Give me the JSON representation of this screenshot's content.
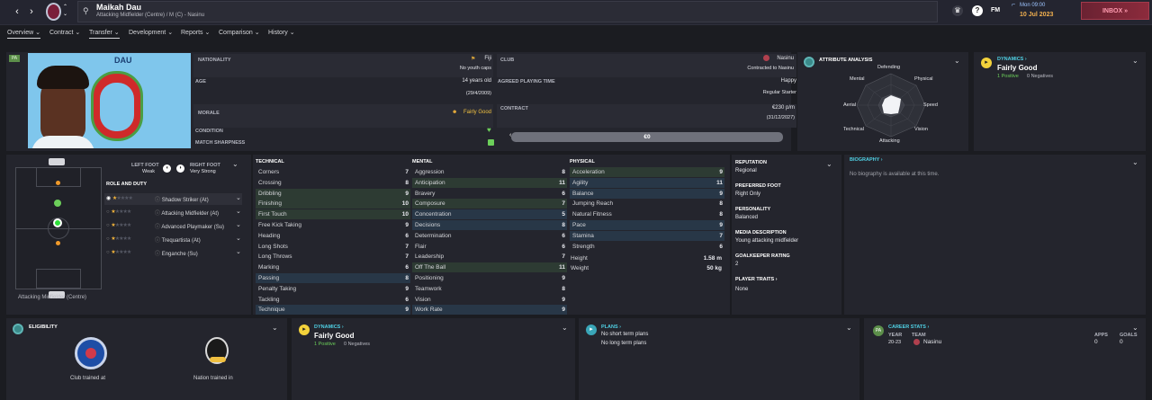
{
  "topbar": {
    "name": "Maikah Dau",
    "subtitle": "Attacking Midfielder (Centre) / M (C) - Nasinu",
    "day": "Mon 09:00",
    "date": "10 Jul 2023",
    "fm": "FM",
    "inbox": "INBOX"
  },
  "tabs": [
    {
      "label": "Overview"
    },
    {
      "label": "Contract"
    },
    {
      "label": "Transfer"
    },
    {
      "label": "Development"
    },
    {
      "label": "Reports"
    },
    {
      "label": "Comparison"
    },
    {
      "label": "History"
    }
  ],
  "profile": {
    "shirt_name": "DAU",
    "shirt_number": "0",
    "badge": "PA",
    "nationality_label": "NATIONALITY",
    "nationality": "Fiji",
    "youth_caps": "No youth caps",
    "club_label": "CLUB",
    "club": "Nasinu",
    "contracted": "Contracted to Nasinu",
    "age_label": "AGE",
    "age": "14 years old",
    "dob": "(29/4/2009)",
    "apt_label": "AGREED PLAYING TIME",
    "apt1": "Happy",
    "apt2": "Regular Starter",
    "morale_label": "MORALE",
    "morale": "Fairly Good",
    "contract_label": "CONTRACT",
    "wage": "€230 p/m",
    "expiry": "(31/12/2027)",
    "condition_label": "CONDITION",
    "sharpness_label": "MATCH SHARPNESS",
    "value": "€0"
  },
  "attr_analysis": {
    "title": "ATTRIBUTE ANALYSIS",
    "labels": [
      "Defending",
      "Physical",
      "Speed",
      "Vision",
      "Attacking",
      "Technical",
      "Aerial",
      "Mental"
    ]
  },
  "dynamics": {
    "title": "DYNAMICS",
    "value": "Fairly Good",
    "positive": "1 Positive",
    "negatives": "0 Negatives"
  },
  "feet": {
    "left_label": "LEFT FOOT",
    "left": "Weak",
    "right_label": "RIGHT FOOT",
    "right": "Very Strong"
  },
  "roles": {
    "title": "ROLE AND DUTY",
    "items": [
      "Shadow Striker (At)",
      "Attacking Midfielder (At)",
      "Advanced Playmaker (Su)",
      "Trequartista (At)",
      "Enganche (Su)"
    ]
  },
  "pitch_caption": "Attacking Midfielder (Centre)",
  "technical": {
    "title": "TECHNICAL",
    "attrs": [
      [
        "Corners",
        "7"
      ],
      [
        "Crossing",
        "8"
      ],
      [
        "Dribbling",
        "9"
      ],
      [
        "Finishing",
        "10"
      ],
      [
        "First Touch",
        "10"
      ],
      [
        "Free Kick Taking",
        "9"
      ],
      [
        "Heading",
        "6"
      ],
      [
        "Long Shots",
        "7"
      ],
      [
        "Long Throws",
        "7"
      ],
      [
        "Marking",
        "6"
      ],
      [
        "Passing",
        "8"
      ],
      [
        "Penalty Taking",
        "9"
      ],
      [
        "Tackling",
        "6"
      ],
      [
        "Technique",
        "9"
      ]
    ]
  },
  "mental": {
    "title": "MENTAL",
    "attrs": [
      [
        "Aggression",
        "8"
      ],
      [
        "Anticipation",
        "11"
      ],
      [
        "Bravery",
        "6"
      ],
      [
        "Composure",
        "7"
      ],
      [
        "Concentration",
        "5"
      ],
      [
        "Decisions",
        "8"
      ],
      [
        "Determination",
        "6"
      ],
      [
        "Flair",
        "6"
      ],
      [
        "Leadership",
        "7"
      ],
      [
        "Off The Ball",
        "11"
      ],
      [
        "Positioning",
        "9"
      ],
      [
        "Teamwork",
        "8"
      ],
      [
        "Vision",
        "9"
      ],
      [
        "Work Rate",
        "9"
      ]
    ]
  },
  "physical": {
    "title": "PHYSICAL",
    "attrs": [
      [
        "Acceleration",
        "9"
      ],
      [
        "Agility",
        "11"
      ],
      [
        "Balance",
        "9"
      ],
      [
        "Jumping Reach",
        "8"
      ],
      [
        "Natural Fitness",
        "8"
      ],
      [
        "Pace",
        "9"
      ],
      [
        "Stamina",
        "7"
      ],
      [
        "Strength",
        "6"
      ]
    ],
    "height_label": "Height",
    "height": "1.58 m",
    "weight_label": "Weight",
    "weight": "50 kg"
  },
  "info": {
    "rep_label": "REPUTATION",
    "rep": "Regional",
    "foot_label": "PREFERRED FOOT",
    "foot": "Right Only",
    "pers_label": "PERSONALITY",
    "pers": "Balanced",
    "media_label": "MEDIA DESCRIPTION",
    "media": "Young attacking midfielder",
    "gk_label": "GOALKEEPER RATING",
    "gk": "2",
    "traits_label": "PLAYER TRAITS",
    "traits": "None"
  },
  "bio": {
    "title": "BIOGRAPHY",
    "text": "No biography is available at this time."
  },
  "bottom": {
    "elig_title": "ELIGIBILITY",
    "club_trained": "Club trained at",
    "nation_trained": "Nation trained in",
    "dyn_title": "DYNAMICS",
    "dyn_value": "Fairly Good",
    "dyn_pos": "1 Positive",
    "dyn_neg": "0 Negatives",
    "plans_title": "PLANS",
    "plan1": "No short term plans",
    "plan2": "No long term plans",
    "career_title": "CAREER STATS",
    "year_h": "YEAR",
    "team_h": "TEAM",
    "apps_h": "APPS",
    "goals_h": "GOALS",
    "year": "20-23",
    "team": "Nasinu",
    "apps": "0",
    "goals": "0"
  },
  "colors": {
    "accent_green": "#6ccf5a",
    "gold": "#f3b43b",
    "inbox": "#8c2b3c"
  }
}
